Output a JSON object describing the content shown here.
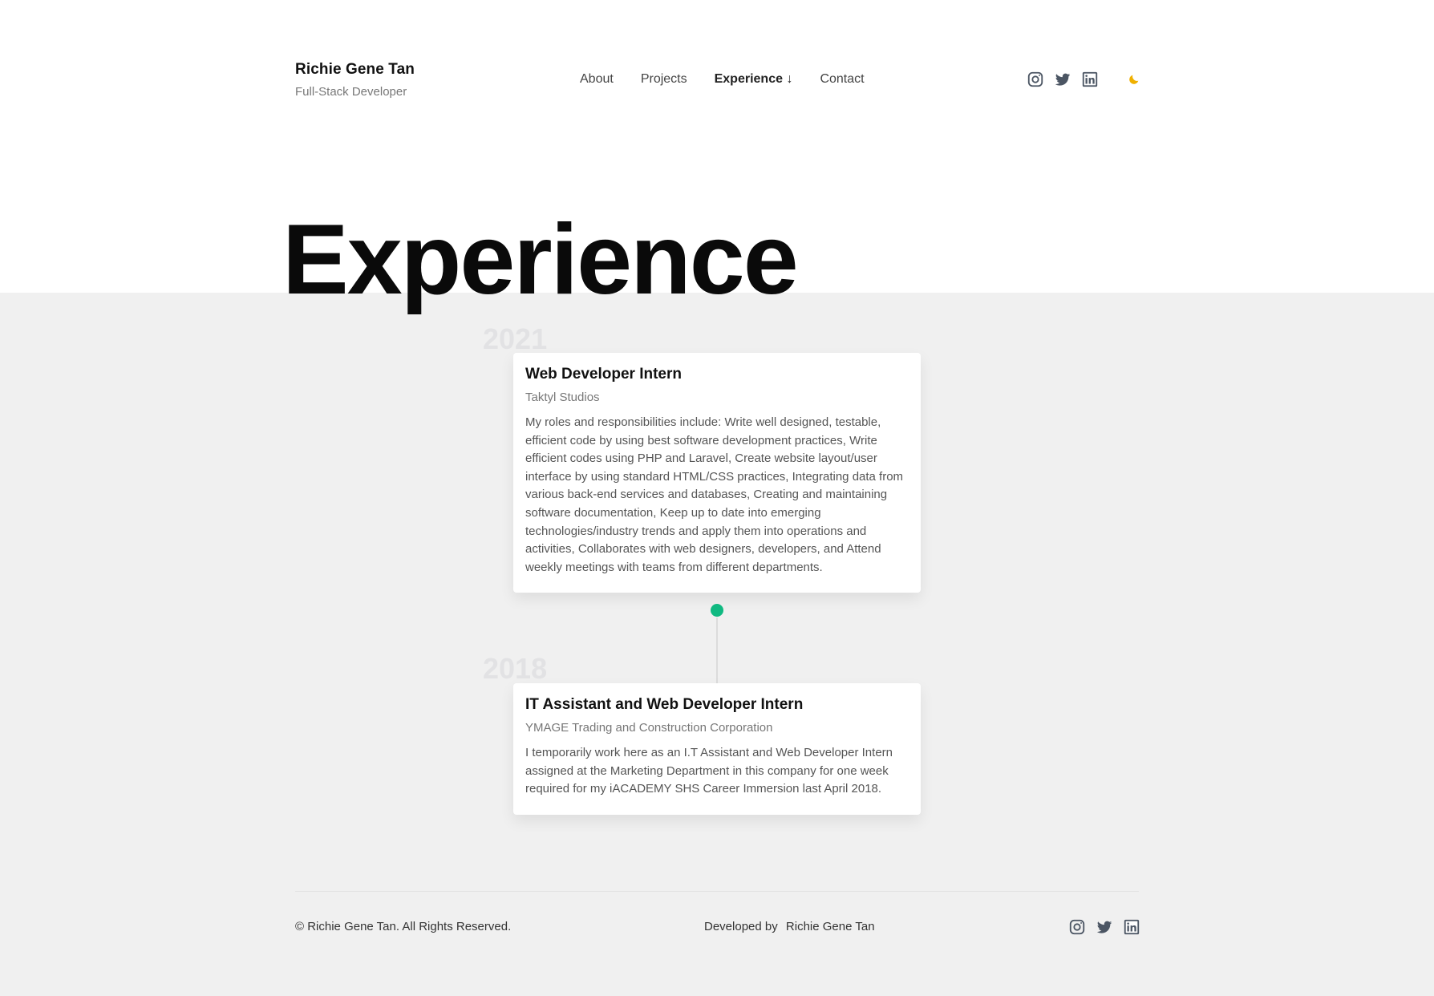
{
  "header": {
    "brand_name": "Richie Gene Tan",
    "brand_role": "Full-Stack Developer",
    "nav": [
      {
        "label": "About"
      },
      {
        "label": "Projects"
      },
      {
        "label": "Experience ↓",
        "active": true
      },
      {
        "label": "Contact"
      }
    ],
    "social_icons": [
      "instagram-icon",
      "twitter-icon",
      "linkedin-icon"
    ],
    "theme_toggle_icon": "moon-icon",
    "theme_toggle_color": "#f0b000"
  },
  "page": {
    "title": "Experience"
  },
  "timeline": {
    "accent_color": "#10b981",
    "entries": [
      {
        "year": "2021",
        "title": "Web Developer Intern",
        "company": "Taktyl Studios",
        "description": "My roles and responsibilities include: Write well designed, testable, efficient code by using best software development practices, Write efficient codes using PHP and Laravel, Create website layout/user interface by using standard HTML/CSS practices, Integrating data from various back-end services and databases, Creating and maintaining software documentation, Keep up to date into emerging technologies/industry trends and apply them into operations and activities, Collaborates with web designers, developers, and Attend weekly meetings with teams from different departments."
      },
      {
        "year": "2018",
        "title": "IT Assistant and Web Developer Intern",
        "company": "YMAGE Trading and Construction Corporation",
        "description": "I temporarily work here as an I.T Assistant and Web Developer Intern assigned at the Marketing Department in this company for one week required for my iACADEMY SHS Career Immersion last April 2018."
      }
    ]
  },
  "footer": {
    "copyright": "© Richie Gene Tan. All Rights Reserved.",
    "developed_by_label": "Developed by",
    "developer_name": "Richie Gene Tan",
    "social_icons": [
      "instagram-icon",
      "twitter-icon",
      "linkedin-icon"
    ]
  }
}
